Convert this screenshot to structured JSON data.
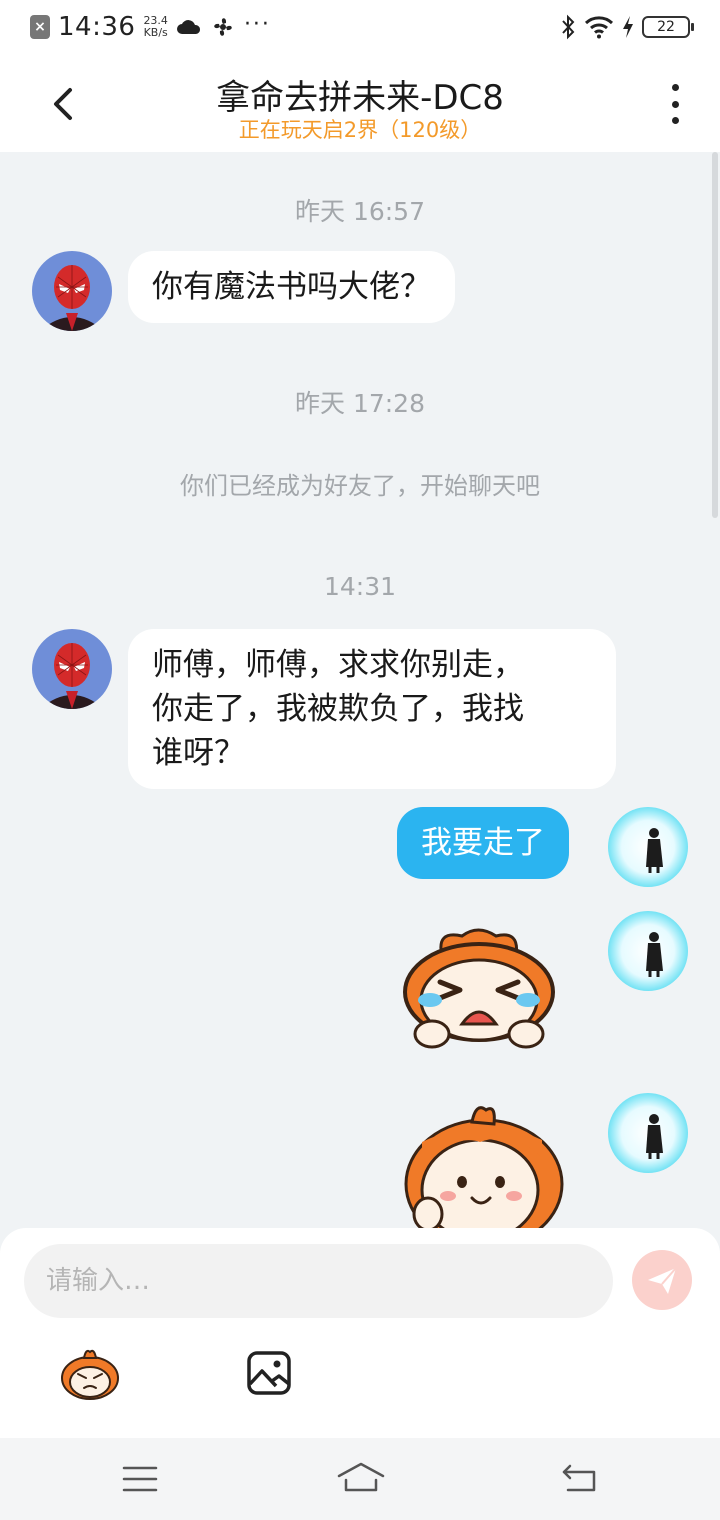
{
  "status_bar": {
    "time": "14:36",
    "net_speed_value": "23.4",
    "net_speed_unit": "KB/s",
    "more_dots": "···",
    "battery": "22"
  },
  "header": {
    "title": "拿命去拼未来-DC8",
    "subtitle": "正在玩天启2界（120级）"
  },
  "chat": {
    "messages": [
      {
        "type": "timestamp",
        "text": "昨天 16:57"
      },
      {
        "type": "incoming",
        "text": "你有魔法书吗大佬？"
      },
      {
        "type": "timestamp",
        "text": "昨天 17:28"
      },
      {
        "type": "system",
        "text": "你们已经成为好友了，开始聊天吧"
      },
      {
        "type": "timestamp",
        "text": "14:31"
      },
      {
        "type": "incoming",
        "lines": [
          "师傅，师傅，求求你别走，",
          "你走了，我被欺负了，我找",
          "谁呀？"
        ]
      },
      {
        "type": "outgoing",
        "text": "我要走了"
      },
      {
        "type": "outgoing-sticker",
        "sticker": "crying-sticker"
      },
      {
        "type": "outgoing-sticker",
        "sticker": "waving-sticker"
      }
    ]
  },
  "input": {
    "placeholder": "请输入…"
  },
  "colors": {
    "accent": "#2bb4f0",
    "subtitle": "#f39a2a",
    "background": "#f0f3f5",
    "send_disabled": "#fbd1cc"
  }
}
